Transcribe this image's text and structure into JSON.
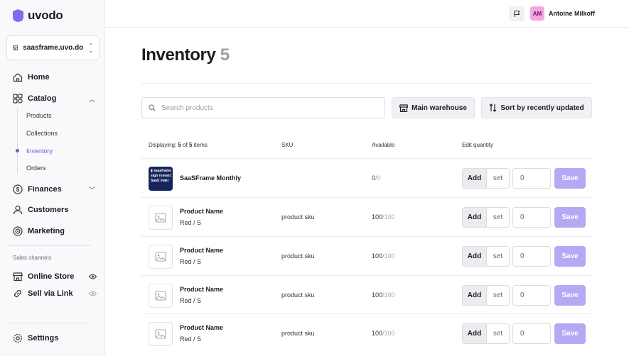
{
  "brand": {
    "name": "uvodo",
    "accent": "#6b5bd6"
  },
  "store": {
    "name": "saasframe.uvo.do"
  },
  "nav": {
    "home": "Home",
    "catalog": "Catalog",
    "catalog_sub": [
      "Products",
      "Collections",
      "Inventory",
      "Orders"
    ],
    "finances": "Finances",
    "customers": "Customers",
    "marketing": "Marketing",
    "sales_channels_label": "Sales channels",
    "online_store": "Online Store",
    "sell_via_link": "Sell via Link",
    "settings": "Settings"
  },
  "user": {
    "initials": "AM",
    "name": "Antoine Milkoff"
  },
  "page": {
    "title": "Inventory",
    "count": "5"
  },
  "toolbar": {
    "search_placeholder": "Search products",
    "warehouse_label": "Main warehouse",
    "sort_label": "Sort by recently updated"
  },
  "table": {
    "displaying_prefix": "Displaying: ",
    "displaying_shown": "5",
    "displaying_of": " of ",
    "displaying_total": "5",
    "displaying_suffix": " items",
    "col_sku": "SKU",
    "col_available": "Available",
    "col_edit": "Edit quantity",
    "add_label": "Add",
    "set_label": "set",
    "qty_value": "0",
    "save_label": "Save",
    "thumb_text": [
      "▮ saasframe",
      "sign researc",
      "SaaS maki"
    ],
    "rows": [
      {
        "name": "SaaSFrame Monthly",
        "variant": "",
        "sku": "",
        "available": "0",
        "total": "/0"
      },
      {
        "name": "Product Name",
        "variant": "Red / S",
        "sku": "product sku",
        "available": "100",
        "total": "/100"
      },
      {
        "name": "Product Name",
        "variant": "Red / S",
        "sku": "product sku",
        "available": "100",
        "total": "/100"
      },
      {
        "name": "Product Name",
        "variant": "Red / S",
        "sku": "product sku",
        "available": "100",
        "total": "/100"
      },
      {
        "name": "Product Name",
        "variant": "Red / S",
        "sku": "product sku",
        "available": "100",
        "total": "/100"
      }
    ]
  }
}
